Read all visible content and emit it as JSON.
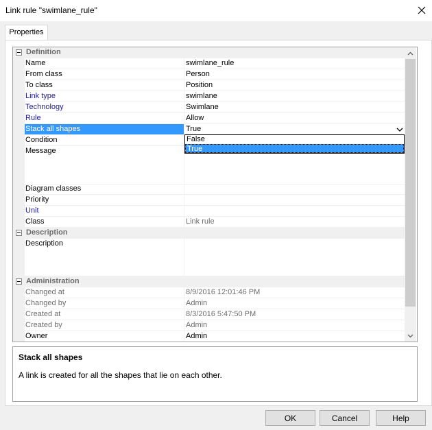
{
  "window": {
    "title": "Link rule \"swimlane_rule\""
  },
  "tabs": [
    {
      "label": "Properties"
    }
  ],
  "grid": {
    "categories": {
      "definition": "Definition",
      "description": "Description",
      "administration": "Administration"
    },
    "definition_rows": [
      {
        "name": "Name",
        "value": "swimlane_rule"
      },
      {
        "name": "From class",
        "value": "Person"
      },
      {
        "name": "To class",
        "value": "Position"
      },
      {
        "name": "Link type",
        "value": "swimlane"
      },
      {
        "name": "Technology",
        "value": "Swimlane"
      },
      {
        "name": "Rule",
        "value": "Allow"
      },
      {
        "name": "Stack all shapes",
        "value": "True"
      },
      {
        "name": "Condition",
        "value": ""
      },
      {
        "name": "Message",
        "value": ""
      },
      {
        "name": "Diagram classes",
        "value": ""
      },
      {
        "name": "Priority",
        "value": ""
      },
      {
        "name": "Unit",
        "value": ""
      },
      {
        "name": "Class",
        "value": "Link rule"
      }
    ],
    "description_rows": [
      {
        "name": "Description",
        "value": ""
      }
    ],
    "administration_rows": [
      {
        "name": "Changed at",
        "value": "8/9/2016 12:01:46 PM"
      },
      {
        "name": "Changed by",
        "value": "Admin"
      },
      {
        "name": "Created at",
        "value": "8/3/2016 5:47:50 PM"
      },
      {
        "name": "Created by",
        "value": "Admin"
      },
      {
        "name": "Owner",
        "value": "Admin"
      }
    ],
    "dropdown_options": [
      "False",
      "True"
    ],
    "dropdown_selected": "True"
  },
  "help": {
    "title": "Stack all shapes",
    "text": "A link is created for all the shapes that lie on each other."
  },
  "buttons": {
    "ok": "OK",
    "cancel": "Cancel",
    "help": "Help"
  },
  "colors": {
    "selection": "#3399ff",
    "link_blue": "#1c1c9c",
    "category_grey": "#6d6d6d"
  }
}
